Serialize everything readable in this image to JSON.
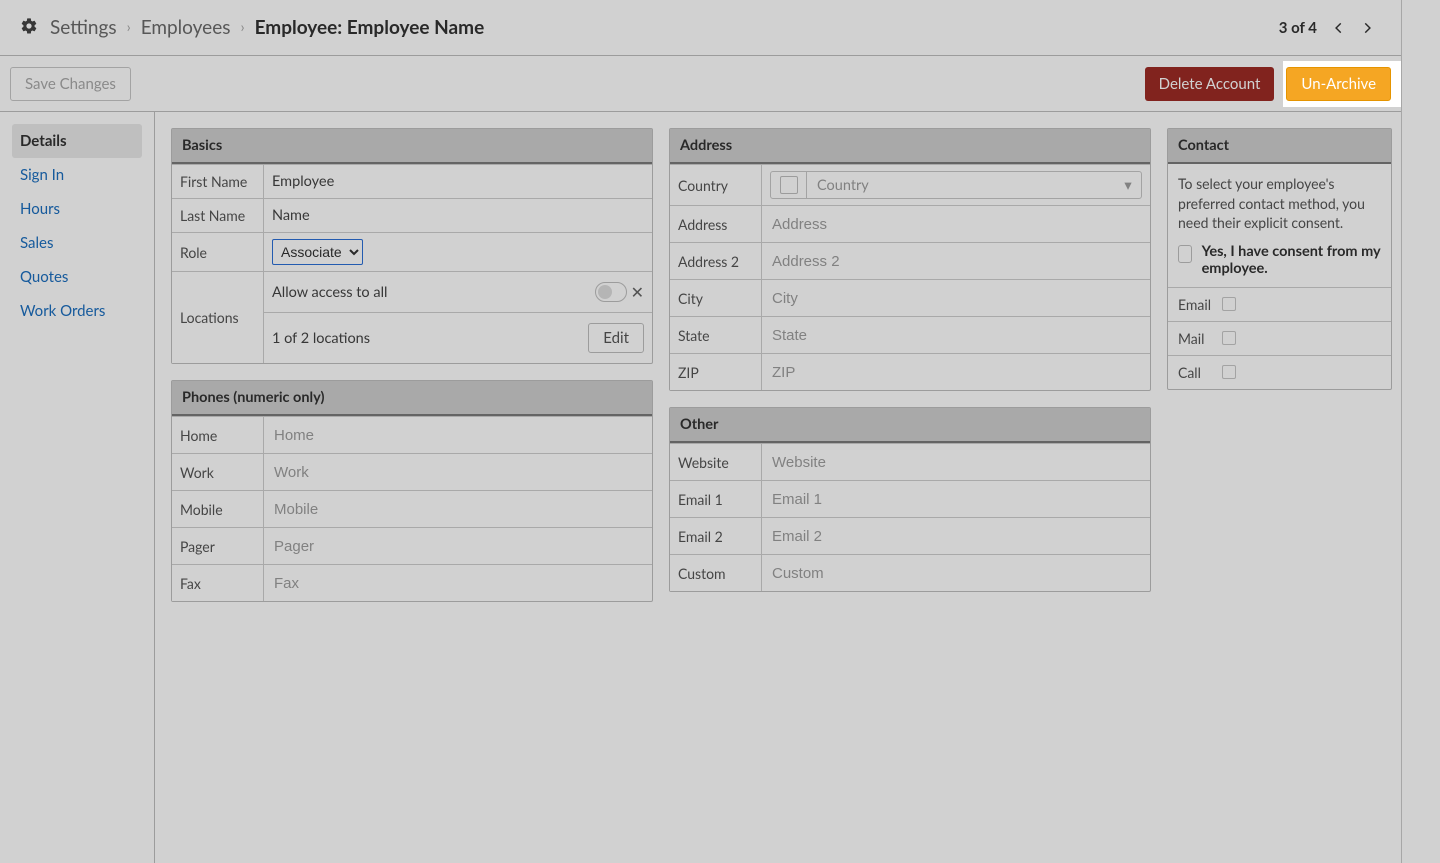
{
  "breadcrumb": {
    "settings": "Settings",
    "employees": "Employees",
    "current": "Employee: Employee Name"
  },
  "pager": {
    "text": "3 of 4"
  },
  "actions": {
    "save": "Save Changes",
    "delete": "Delete Account",
    "unarchive": "Un-Archive"
  },
  "sidebar": {
    "items": [
      {
        "label": "Details",
        "active": true
      },
      {
        "label": "Sign In"
      },
      {
        "label": "Hours"
      },
      {
        "label": "Sales"
      },
      {
        "label": "Quotes"
      },
      {
        "label": "Work Orders"
      }
    ]
  },
  "basics": {
    "title": "Basics",
    "first_name_label": "First Name",
    "first_name_value": "Employee",
    "last_name_label": "Last Name",
    "last_name_value": "Name",
    "role_label": "Role",
    "role_value": "Associate",
    "locations_label": "Locations",
    "allow_access_label": "Allow access to all",
    "locations_summary": "1 of 2 locations",
    "edit_label": "Edit"
  },
  "phones": {
    "title": "Phones (numeric only)",
    "fields": [
      {
        "label": "Home",
        "placeholder": "Home"
      },
      {
        "label": "Work",
        "placeholder": "Work"
      },
      {
        "label": "Mobile",
        "placeholder": "Mobile"
      },
      {
        "label": "Pager",
        "placeholder": "Pager"
      },
      {
        "label": "Fax",
        "placeholder": "Fax"
      }
    ]
  },
  "address": {
    "title": "Address",
    "country_label": "Country",
    "country_placeholder": "Country",
    "address_label": "Address",
    "address_placeholder": "Address",
    "address2_label": "Address 2",
    "address2_placeholder": "Address 2",
    "city_label": "City",
    "city_placeholder": "City",
    "state_label": "State",
    "state_placeholder": "State",
    "zip_label": "ZIP",
    "zip_placeholder": "ZIP"
  },
  "other": {
    "title": "Other",
    "website_label": "Website",
    "website_placeholder": "Website",
    "email1_label": "Email 1",
    "email1_placeholder": "Email 1",
    "email2_label": "Email 2",
    "email2_placeholder": "Email 2",
    "custom_label": "Custom",
    "custom_placeholder": "Custom"
  },
  "contact": {
    "title": "Contact",
    "explain": "To select your employee's preferred contact method, you need their explicit consent.",
    "consent_label": "Yes, I have consent from my employee.",
    "methods": [
      {
        "label": "Email"
      },
      {
        "label": "Mail"
      },
      {
        "label": "Call"
      }
    ]
  }
}
